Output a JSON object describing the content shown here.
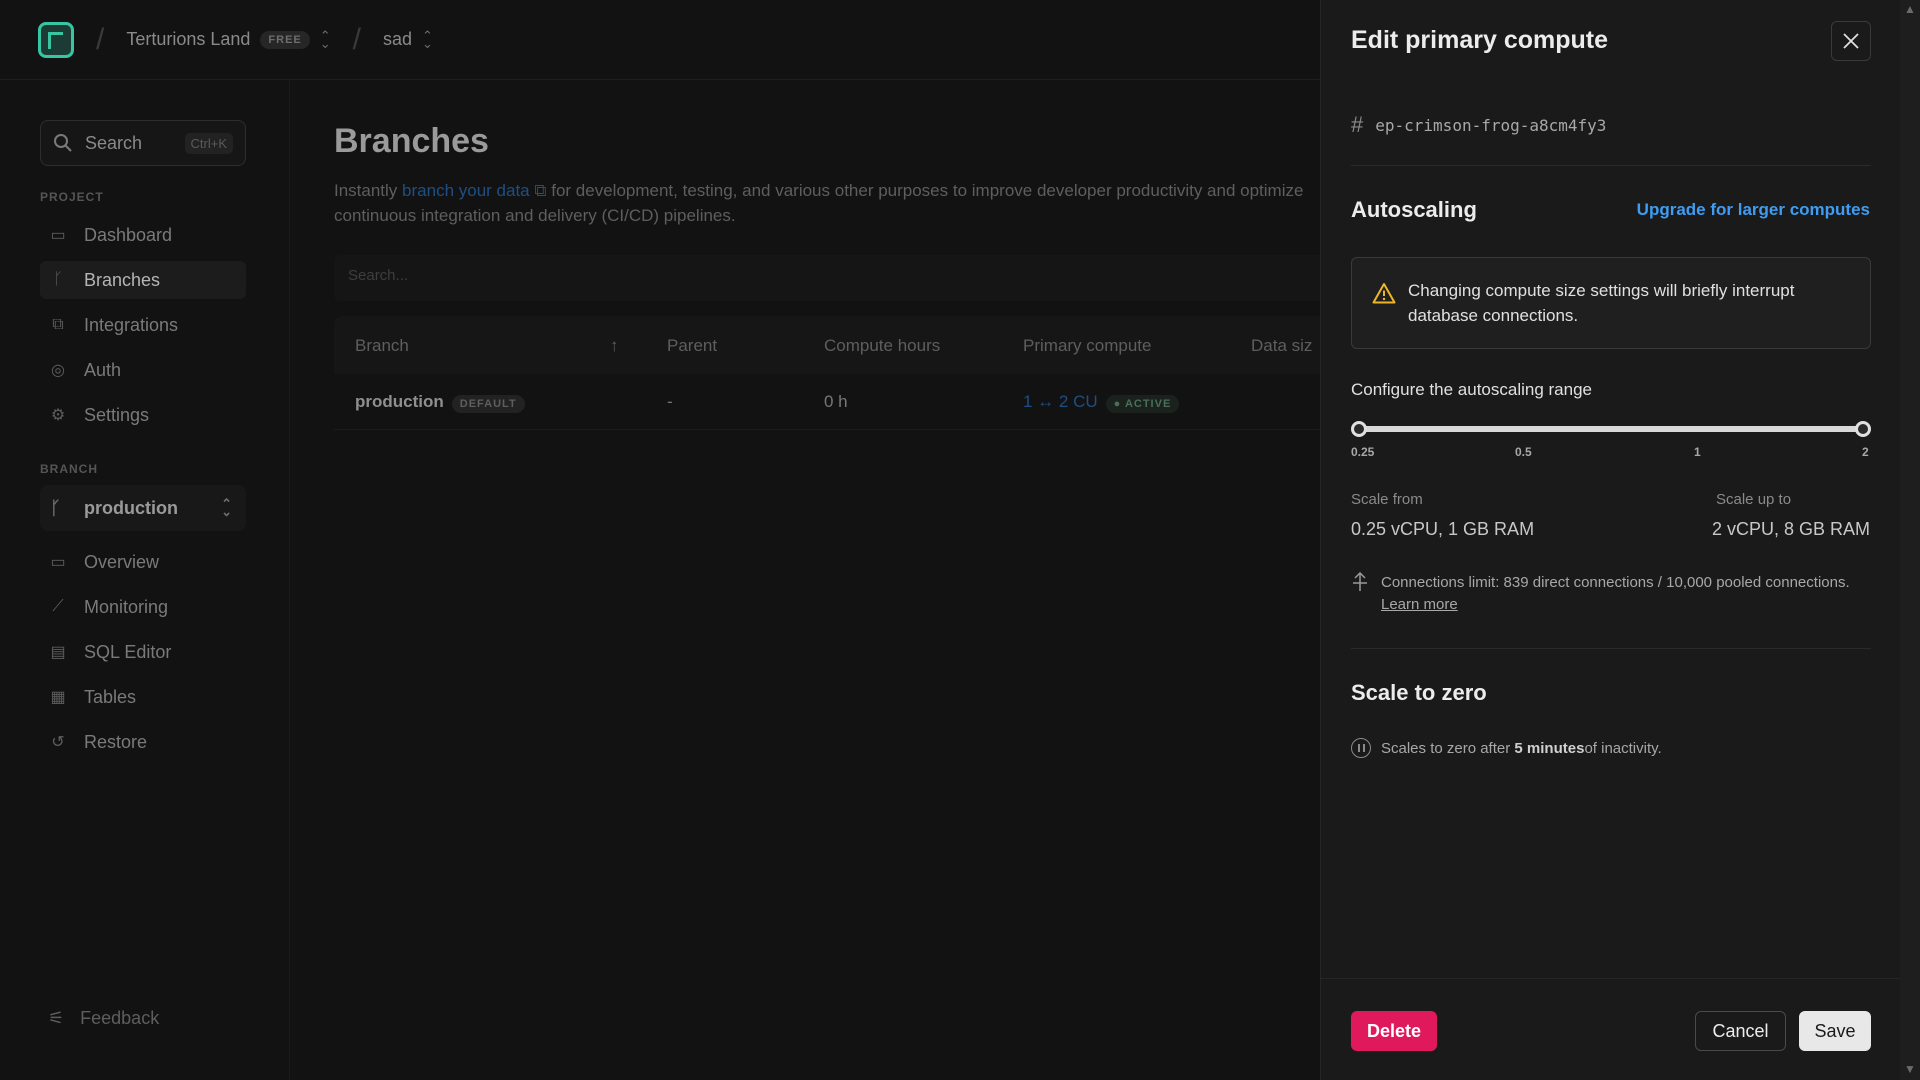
{
  "header": {
    "project_name": "Terturions Land",
    "plan_badge": "FREE",
    "branch_crumb": "sad"
  },
  "sidebar": {
    "search_label": "Search",
    "search_shortcut": "Ctrl+K",
    "project_section": "PROJECT",
    "project_items": [
      {
        "label": "Dashboard",
        "icon": "dashboard-icon"
      },
      {
        "label": "Branches",
        "icon": "branch-icon"
      },
      {
        "label": "Integrations",
        "icon": "integrations-icon"
      },
      {
        "label": "Auth",
        "icon": "auth-icon"
      },
      {
        "label": "Settings",
        "icon": "gear-icon"
      }
    ],
    "branch_section": "BRANCH",
    "branch_selected": "production",
    "branch_items": [
      {
        "label": "Overview",
        "icon": "overview-icon"
      },
      {
        "label": "Monitoring",
        "icon": "chart-icon"
      },
      {
        "label": "SQL Editor",
        "icon": "sql-icon"
      },
      {
        "label": "Tables",
        "icon": "table-icon"
      },
      {
        "label": "Restore",
        "icon": "restore-icon"
      }
    ],
    "feedback": "Feedback"
  },
  "main": {
    "title": "Branches",
    "desc_before": "Instantly ",
    "desc_link": "branch your data",
    "desc_after": " for development, testing, and various other purposes to improve developer productivity and optimize continuous integration and delivery (CI/CD) pipelines.",
    "search_placeholder": "Search...",
    "columns": [
      "Branch",
      "Parent",
      "Compute hours",
      "Primary compute",
      "Data siz"
    ],
    "row": {
      "branch": "production",
      "branch_tag": "DEFAULT",
      "parent": "-",
      "compute_hours": "0 h",
      "compute": "1 ↔ 2 CU",
      "status": "ACTIVE"
    }
  },
  "drawer": {
    "title": "Edit primary compute",
    "endpoint_id": "ep-crimson-frog-a8cm4fy3",
    "autoscaling_heading": "Autoscaling",
    "upgrade_link": "Upgrade for larger computes",
    "warning_text": "Changing compute size settings will briefly interrupt database connections.",
    "configure_label": "Configure the autoscaling range",
    "slider": {
      "ticks": [
        "0.25",
        "0.5",
        "1",
        "2"
      ],
      "min_value": 0.25,
      "max_value": 2
    },
    "scale_from_label": "Scale from",
    "scale_from_value": "0.25 vCPU, 1 GB RAM",
    "scale_up_label": "Scale up to",
    "scale_up_value": "2 vCPU, 8 GB RAM",
    "connections_text": "Connections limit: 839 direct connections / 10,000 pooled connections.",
    "learn_more": "Learn more",
    "scale_zero_heading": "Scale to zero",
    "scale_zero_before": "Scales to zero after ",
    "scale_zero_bold": "5 minutes",
    "scale_zero_after": " of inactivity.",
    "delete_label": "Delete",
    "cancel_label": "Cancel",
    "save_label": "Save"
  },
  "colors": {
    "accent_link": "#3f9cf2",
    "delete": "#e0185c",
    "brand": "#37c6a1"
  }
}
